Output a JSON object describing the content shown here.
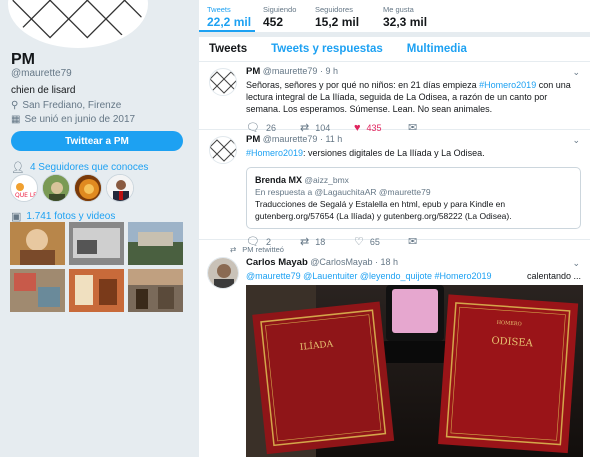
{
  "profile": {
    "name": "PM",
    "handle": "@maurette79",
    "bio": "chien de lisard",
    "location": "San Frediano, Firenze",
    "joined": "Se unió en junio de 2017",
    "tweet_to_button": "Twittear a PM",
    "followers_known": "4 Seguidores que conoces",
    "photos_videos": "1.741 fotos y videos"
  },
  "stats": [
    {
      "label": "Tweets",
      "value": "22,2 mil",
      "active": true
    },
    {
      "label": "Siguiendo",
      "value": "452",
      "active": false
    },
    {
      "label": "Seguidores",
      "value": "15,2 mil",
      "active": false
    },
    {
      "label": "Me gusta",
      "value": "32,3 mil",
      "active": false
    }
  ],
  "tabs": [
    {
      "label": "Tweets",
      "selected": true
    },
    {
      "label": "Tweets y respuestas",
      "selected": false
    },
    {
      "label": "Multimedia",
      "selected": false
    }
  ],
  "tweets": [
    {
      "name": "PM",
      "handle": "@maurette79",
      "time": "· 9 h",
      "text_before": "Señoras, señores y por qué no niños: en 21 días empieza ",
      "hashtag": "#Homero2019",
      "text_after": " con una lectura integral de La Ilíada, seguida de La Odisea, a razón de un canto por semana. Los esperamos. Súmense. Lean. No sean animales.",
      "replies": "26",
      "retweets": "104",
      "likes": "435"
    },
    {
      "name": "PM",
      "handle": "@maurette79",
      "time": "· 11 h",
      "hashtag": "#Homero2019",
      "text_after": ": versiones digitales de La Ilíada y La Odisea.",
      "quote": {
        "name": "Brenda MX",
        "handle": "@aizz_bmx",
        "reply_to": "En respuesta a @LagauchitaAR @maurette79",
        "text": "Traducciones de Segalá y Estalella en html, epub y para Kindle en gutenberg.org/57654  (La Ilíada) y gutenberg.org/58222 (La Odisea)."
      },
      "replies": "2",
      "retweets": "18",
      "likes": "65"
    },
    {
      "retweeted_by": "PM retwitteó",
      "name": "Carlos Mayab",
      "handle": "@CarlosMayab",
      "time": "· 18 h",
      "mentions": "@maurette79 @Lauentuiter @leyendo_quijote #Homero2019",
      "trailing": "calentando ..."
    }
  ],
  "media": {
    "book1_title": "ILÍADA",
    "book2_title": "ODISEA",
    "book2_author": "HOMERO"
  },
  "colors": {
    "accent": "#1da1f2",
    "like": "#e0245e",
    "bg": "#e6ecf0"
  }
}
